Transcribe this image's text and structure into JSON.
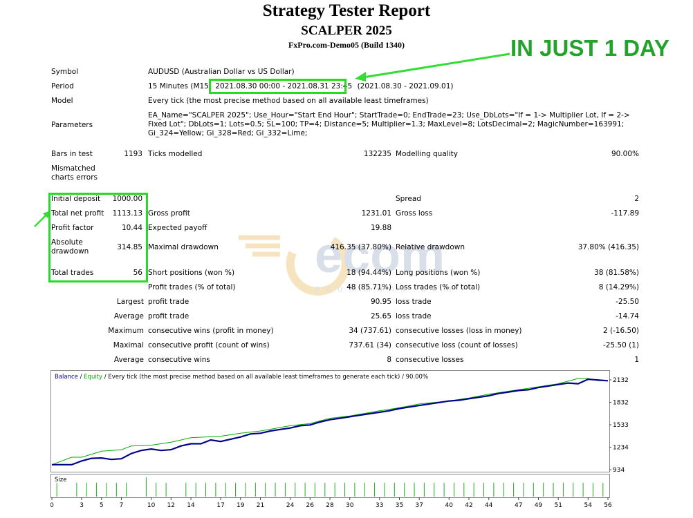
{
  "report": {
    "title": "Strategy Tester Report",
    "subtitle": "SCALPER 2025",
    "server": "FxPro.com-Demo05 (Build 1340)"
  },
  "banner": "IN JUST 1 DAY",
  "watermark": {
    "letters": "ecom",
    "tagline": "e c o m m o n s . c o m"
  },
  "rows": {
    "symbol": {
      "label": "Symbol",
      "value": "AUDUSD (Australian Dollar vs US Dollar)"
    },
    "period": {
      "label": "Period",
      "value_prefix": "15 Minutes (M15)",
      "value_highlight": "2021.08.30 00:00 - 2021.08.31 23:45",
      "value_suffix": "(2021.08.30 - 2021.09.01)"
    },
    "model": {
      "label": "Model",
      "value": "Every tick (the most precise method based on all available least timeframes)"
    },
    "parameters": {
      "label": "Parameters",
      "value": "EA_Name=\"SCALPER 2025\"; Use_Hour=\"Start End Hour\"; StartTrade=0; EndTrade=23; Use_DbLots=\"If = 1-> Multiplier Lot, If = 2-> Fixed Lot\"; DbLots=1; Lots=0.5; SL=100; TP=4; Distance=5; Multiplier=1.3; MaxLevel=8; LotsDecimal=2; MagicNumber=163991; Gi_324=Yellow; Gi_328=Red; Gi_332=Lime;"
    }
  },
  "stats": {
    "bars_in_test": {
      "label": "Bars in test",
      "value": "1193"
    },
    "ticks_modelled": {
      "label": "Ticks modelled",
      "value": "132235"
    },
    "modelling_quality": {
      "label": "Modelling quality",
      "value": "90.00%"
    },
    "mismatched": {
      "label": "Mismatched charts errors"
    },
    "initial_deposit": {
      "label": "Initial deposit",
      "value": "1000.00"
    },
    "spread": {
      "label": "Spread",
      "value": "2"
    },
    "total_net_profit": {
      "label": "Total net profit",
      "value": "1113.13"
    },
    "gross_profit": {
      "label": "Gross profit",
      "value": "1231.01"
    },
    "gross_loss": {
      "label": "Gross loss",
      "value": "-117.89"
    },
    "profit_factor": {
      "label": "Profit factor",
      "value": "10.44"
    },
    "expected_payoff": {
      "label": "Expected payoff",
      "value": "19.88"
    },
    "absolute_drawdown": {
      "label": "Absolute drawdown",
      "value": "314.85"
    },
    "maximal_drawdown": {
      "label": "Maximal drawdown",
      "value": "416.35 (37.80%)"
    },
    "relative_drawdown": {
      "label": "Relative drawdown",
      "value": "37.80% (416.35)"
    },
    "total_trades": {
      "label": "Total trades",
      "value": "56"
    },
    "short_positions": {
      "label": "Short positions (won %)",
      "value": "18 (94.44%)"
    },
    "long_positions": {
      "label": "Long positions (won %)",
      "value": "38 (81.58%)"
    },
    "profit_trades": {
      "label": "Profit trades (% of total)",
      "value": "48 (85.71%)"
    },
    "loss_trades": {
      "label": "Loss trades (% of total)",
      "value": "8 (14.29%)"
    },
    "largest": {
      "prefix": "Largest",
      "label1": "profit trade",
      "value1": "90.95",
      "label2": "loss trade",
      "value2": "-25.50"
    },
    "average": {
      "prefix": "Average",
      "label1": "profit trade",
      "value1": "25.65",
      "label2": "loss trade",
      "value2": "-14.74"
    },
    "maximum": {
      "prefix": "Maximum",
      "label1": "consecutive wins (profit in money)",
      "value1": "34 (737.61)",
      "label2": "consecutive losses (loss in money)",
      "value2": "2 (-16.50)"
    },
    "maximal": {
      "prefix": "Maximal",
      "label1": "consecutive profit (count of wins)",
      "value1": "737.61 (34)",
      "label2": "consecutive loss (count of losses)",
      "value2": "-25.50 (1)"
    },
    "average2": {
      "prefix": "Average",
      "label1": "consecutive wins",
      "value1": "8",
      "label2": "consecutive losses",
      "value2": "1"
    }
  },
  "chart_header": {
    "balance": "Balance",
    "sep": " / ",
    "equity": "Equity",
    "rest": " / Every tick (the most precise method based on all available least timeframes to generate each tick) / 90.00%"
  },
  "colors": {
    "balance": "#00008b",
    "equity": "#00aa00",
    "highlight": "#22dd22",
    "banner": "#23a32c",
    "size_bars": "#22aa22"
  },
  "chart_data": {
    "type": "line",
    "yticks": [
      "2132",
      "1832",
      "1533",
      "1234",
      "934"
    ],
    "ytick_values": [
      2132,
      1832,
      1533,
      1234,
      934
    ],
    "ylim": [
      934,
      2132
    ],
    "xlim": [
      0,
      56
    ],
    "size_label": "Size",
    "xticks": [
      "0",
      "3",
      "5",
      "7",
      "10",
      "12",
      "14",
      "17",
      "19",
      "21",
      "24",
      "26",
      "28",
      "30",
      "33",
      "35",
      "37",
      "40",
      "42",
      "44",
      "47",
      "49",
      "51",
      "54",
      "56"
    ],
    "xtick_values": [
      0,
      3,
      5,
      7,
      10,
      12,
      14,
      17,
      19,
      21,
      24,
      26,
      28,
      30,
      33,
      35,
      37,
      40,
      42,
      44,
      47,
      49,
      51,
      54,
      56
    ],
    "series": [
      {
        "name": "Balance",
        "x": [
          0,
          2,
          3,
          4,
          5,
          6,
          7,
          8,
          9,
          10,
          11,
          12,
          13,
          14,
          15,
          16,
          17,
          18,
          19,
          20,
          21,
          22,
          23,
          24,
          25,
          26,
          27,
          28,
          29,
          30,
          31,
          32,
          33,
          34,
          35,
          36,
          37,
          38,
          39,
          40,
          41,
          42,
          43,
          44,
          45,
          46,
          47,
          48,
          49,
          50,
          51,
          52,
          53,
          54,
          55,
          56
        ],
        "y": [
          1000,
          1000,
          1050,
          1085,
          1090,
          1070,
          1080,
          1150,
          1190,
          1210,
          1190,
          1200,
          1250,
          1280,
          1280,
          1330,
          1310,
          1340,
          1370,
          1410,
          1420,
          1450,
          1470,
          1490,
          1520,
          1530,
          1570,
          1600,
          1620,
          1640,
          1660,
          1680,
          1700,
          1720,
          1750,
          1770,
          1790,
          1810,
          1830,
          1850,
          1860,
          1880,
          1900,
          1920,
          1950,
          1970,
          1990,
          2000,
          2030,
          2050,
          2070,
          2090,
          2080,
          2140,
          2130,
          2120
        ]
      },
      {
        "name": "Equity",
        "x": [
          0,
          2,
          3,
          5,
          7,
          8,
          10,
          12,
          14,
          17,
          19,
          21,
          24,
          26,
          28,
          30,
          33,
          35,
          37,
          40,
          42,
          44,
          47,
          49,
          51,
          53,
          54,
          55,
          56
        ],
        "y": [
          1000,
          1100,
          1100,
          1180,
          1200,
          1250,
          1260,
          1300,
          1360,
          1380,
          1420,
          1450,
          1520,
          1550,
          1620,
          1650,
          1720,
          1760,
          1810,
          1850,
          1890,
          1940,
          2000,
          2040,
          2080,
          2150,
          2150,
          2120,
          2120
        ]
      }
    ],
    "sizes": [
      1,
      0,
      1,
      1,
      1,
      1,
      1,
      1,
      0,
      1,
      1,
      1,
      0,
      1,
      1,
      1,
      1,
      1,
      1,
      1,
      1,
      1,
      1,
      1,
      1,
      1,
      1,
      1,
      1,
      1,
      1,
      1,
      1,
      1,
      1,
      1,
      1,
      1,
      1,
      1,
      1,
      1,
      1,
      1,
      1,
      1,
      1,
      1,
      1,
      1,
      1,
      1,
      1,
      1,
      1,
      1
    ]
  }
}
